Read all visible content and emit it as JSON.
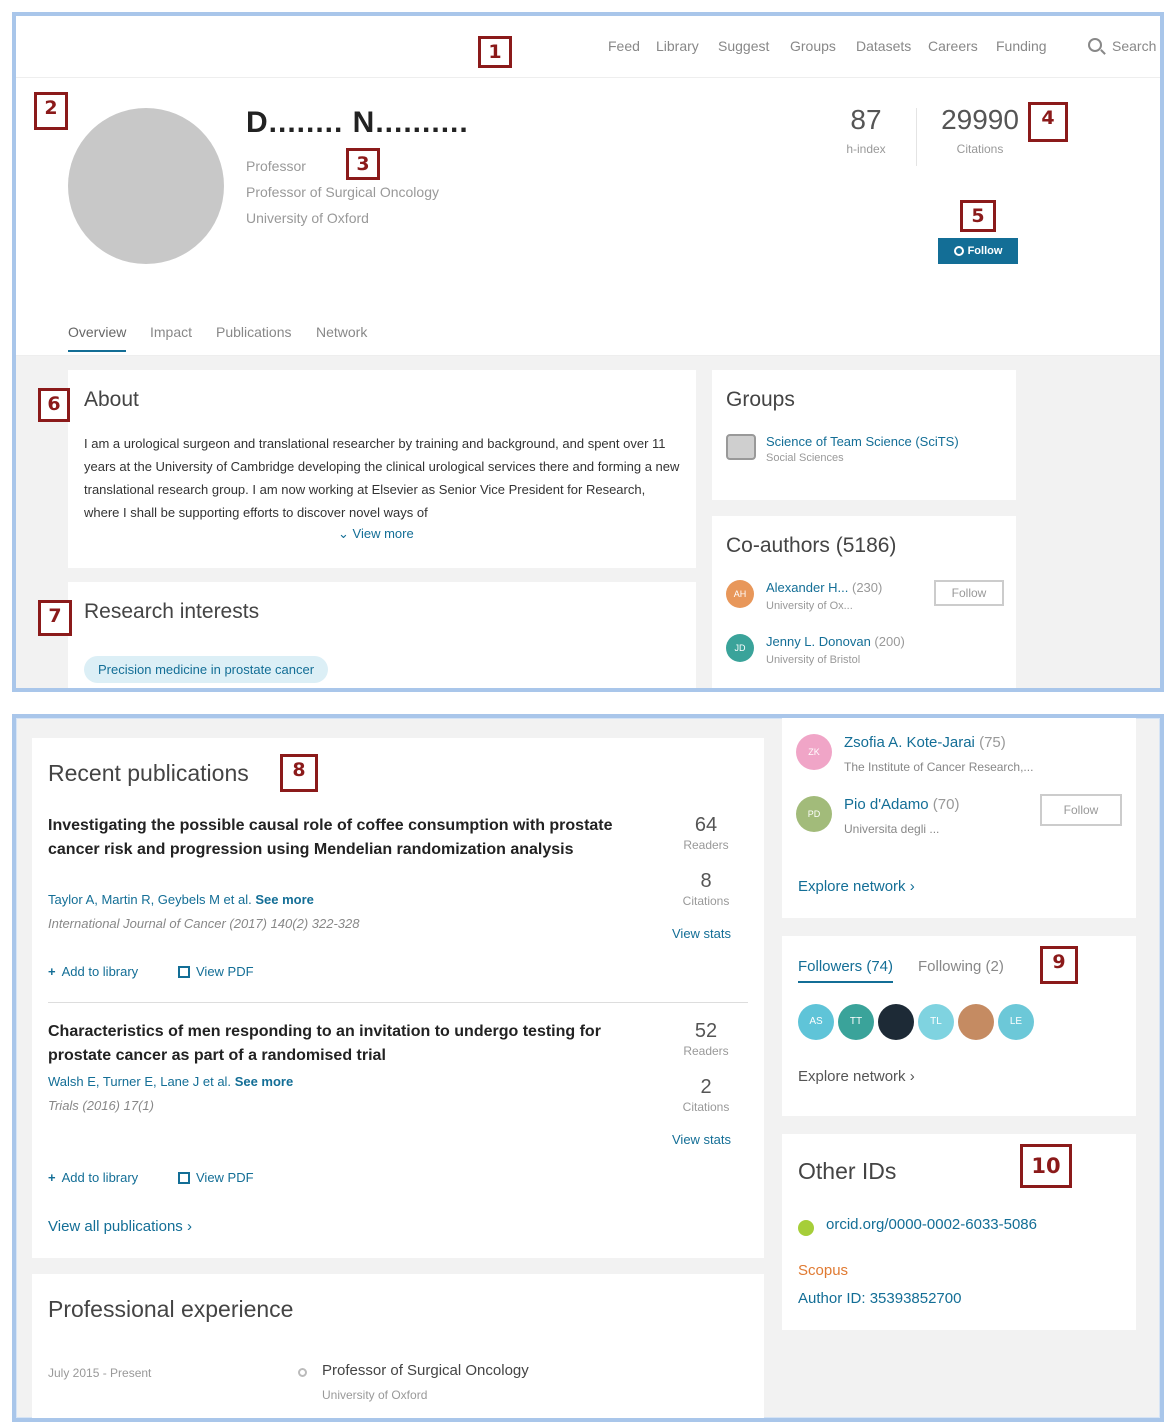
{
  "nav": {
    "items": [
      "Feed",
      "Library",
      "Suggest",
      "Groups",
      "Datasets",
      "Careers",
      "Funding"
    ],
    "search_label": "Search"
  },
  "markers": [
    "1",
    "2",
    "3",
    "4",
    "5",
    "6",
    "7",
    "8",
    "9",
    "10"
  ],
  "profile": {
    "name": "D........ N..........",
    "position": "Professor",
    "role": "Professor of Surgical Oncology",
    "institution": "University of Oxford",
    "h_index_value": "87",
    "h_index_label": "h-index",
    "citations_value": "29990",
    "citations_label": "Citations",
    "follow_label": "Follow"
  },
  "tabs": [
    "Overview",
    "Impact",
    "Publications",
    "Network"
  ],
  "about": {
    "title": "About",
    "text": "I am a urological surgeon and translational researcher by training and background, and spent over 11 years at the University of Cambridge developing the clinical urological services there and forming a new translational research group.  I am now working at Elsevier as Senior Vice President for Research, where I shall be supporting efforts to discover novel ways of",
    "view_more": "View more"
  },
  "research_interests": {
    "title": "Research interests",
    "chips": [
      "Precision medicine in prostate cancer"
    ]
  },
  "groups": {
    "title": "Groups",
    "items": [
      {
        "name": "Science of Team Science (SciTS)",
        "sub": "Social Sciences"
      }
    ]
  },
  "coauthors": {
    "title": "Co-authors (5186)",
    "follow_label": "Follow",
    "items": [
      {
        "initials": "AH",
        "name": "Alexander H...",
        "count": "(230)",
        "affil": "University of Ox...",
        "color": "#e8975a"
      },
      {
        "initials": "JD",
        "name": "Jenny L. Donovan",
        "count": "(200)",
        "affil": "University of Bristol",
        "color": "#3aa39a"
      },
      {
        "initials": "ZK",
        "name": "Zsofia A. Kote-Jarai",
        "count": "(75)",
        "affil": "The Institute of Cancer Research,...",
        "color": "#f0a5c7"
      },
      {
        "initials": "PD",
        "name": "Pio d'Adamo",
        "count": "(70)",
        "affil": "Universita degli ...",
        "color": "#a2bb7a"
      }
    ],
    "explore_label": "Explore network"
  },
  "publications": {
    "title": "Recent publications",
    "items": [
      {
        "title": "Investigating the possible causal role of coffee consumption with prostate cancer risk and progression using Mendelian randomization analysis",
        "authors": "Taylor A, Martin R, Geybels M et al.",
        "see_more": "See more",
        "journal": "International Journal of Cancer (2017) 140(2) 322-328",
        "readers": "64",
        "readers_label": "Readers",
        "citations": "8",
        "citations_label": "Citations",
        "view_stats": "View stats",
        "add_library": "Add to library",
        "view_pdf": "View PDF"
      },
      {
        "title": "Characteristics of men responding to an invitation to undergo testing for prostate cancer as part of a randomised trial",
        "authors": "Walsh E, Turner E, Lane J et al.",
        "see_more": "See more",
        "journal": "Trials (2016) 17(1)",
        "readers": "52",
        "readers_label": "Readers",
        "citations": "2",
        "citations_label": "Citations",
        "view_stats": "View stats",
        "add_library": "Add to library",
        "view_pdf": "View PDF"
      }
    ],
    "view_all": "View all publications"
  },
  "followers": {
    "followers_tab": "Followers (74)",
    "following_tab": "Following (2)",
    "avatars": [
      {
        "initials": "AS",
        "color": "#5fc4d8"
      },
      {
        "initials": "TT",
        "color": "#3aa39a"
      },
      {
        "initials": "",
        "color": "#1d2a36"
      },
      {
        "initials": "TL",
        "color": "#7fd3e0"
      },
      {
        "initials": "",
        "color": "#c58b62"
      },
      {
        "initials": "LE",
        "color": "#6cc8d8"
      }
    ],
    "explore_label": "Explore network"
  },
  "other_ids": {
    "title": "Other IDs",
    "orcid": "orcid.org/0000-0002-6033-5086",
    "scopus_label": "Scopus",
    "author_id": "Author ID: 35393852700"
  },
  "experience": {
    "title": "Professional experience",
    "items": [
      {
        "dates": "July 2015 - Present",
        "role": "Professor of Surgical Oncology",
        "org": "University of Oxford"
      }
    ]
  }
}
